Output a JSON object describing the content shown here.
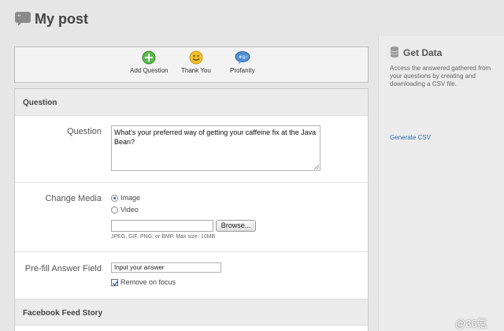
{
  "header": {
    "title": "My post"
  },
  "toolbar": {
    "items": [
      {
        "label": "Add Question",
        "icon": "plus-icon",
        "color": "#5bb84a"
      },
      {
        "label": "Thank You",
        "icon": "smiley-icon",
        "color": "#f2c12e"
      },
      {
        "label": "Profanity",
        "icon": "speech-bubble-icon",
        "color": "#4f8fd6"
      }
    ]
  },
  "sections": {
    "question_title": "Question",
    "facebook_title": "Facebook Feed Story"
  },
  "question": {
    "label": "Question",
    "value": "What's your preferred way of getting your caffeine fix at the Java Bean?"
  },
  "media": {
    "label": "Change Media",
    "options": [
      {
        "label": "Image",
        "checked": true
      },
      {
        "label": "Video",
        "checked": false
      }
    ],
    "browse_label": "Browse...",
    "hint": "JPEG, GIF, PNG, or BMP. Max size: 10MB"
  },
  "prefill": {
    "label": "Pre-fill Answer Field",
    "value": "Input your answer",
    "checkbox_label": "Remove on focus",
    "checkbox_checked": true
  },
  "sidebar": {
    "title": "Get Data",
    "description": "Access the answered gathered from your questions by creating and downloading a CSV file.",
    "link": "Generate CSV"
  },
  "watermark": "@36氪"
}
